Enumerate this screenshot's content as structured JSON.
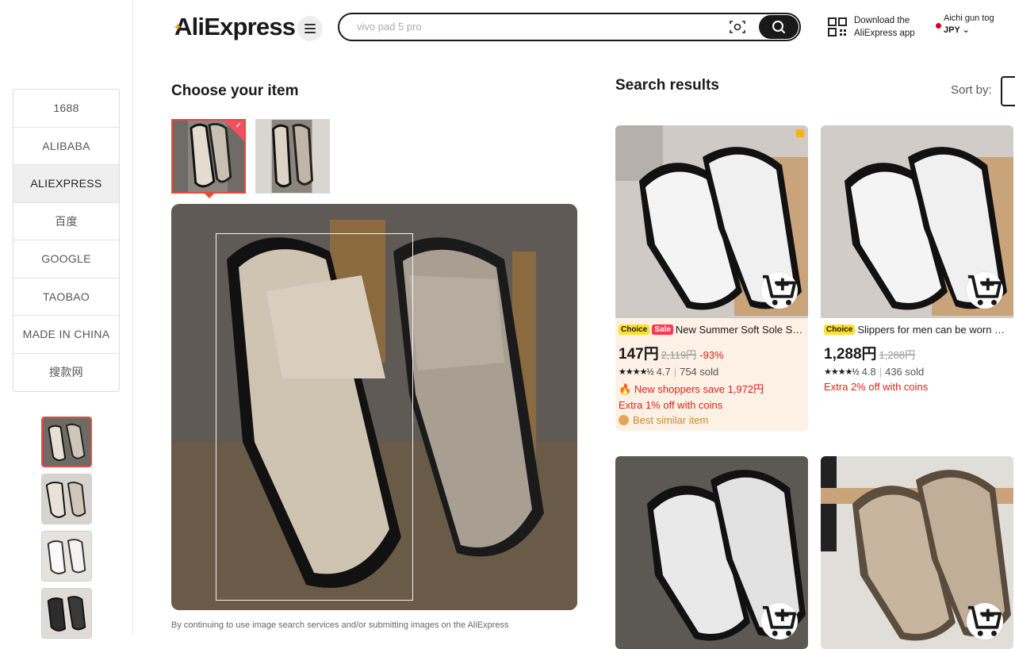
{
  "header": {
    "logo": "AliExpress",
    "search": {
      "placeholder": "vivo pad 5 pro"
    },
    "app_download": {
      "line1": "Download the",
      "line2": "AliExpress app"
    },
    "locale": {
      "location": "Aichi gun tog",
      "currency": "JPY"
    }
  },
  "engines": [
    "1688",
    "ALIBABA",
    "ALIEXPRESS",
    "百度",
    "GOOGLE",
    "TAOBAO",
    "MADE IN CHINA",
    "搜款网"
  ],
  "active_engine": "ALIEXPRESS",
  "choose": {
    "title": "Choose your item",
    "disclaimer": "By continuing to use image search services and/or submitting images on the AliExpress"
  },
  "results": {
    "title": "Search results",
    "sort_label": "Sort by:",
    "cards": [
      {
        "badges": [
          "Choice",
          "Sale"
        ],
        "title": "New Summer Soft Sole Slippers",
        "price": "147円",
        "orig": "2,119円",
        "discount": "-93%",
        "stars": "★★★★½",
        "rating": "4.7",
        "sold": "754 sold",
        "promo1": "New shoppers save 1,972円",
        "promo2": "Extra 1% off with coins",
        "best": "Best similar item"
      },
      {
        "badges": [
          "Choice"
        ],
        "title": "Slippers for men can be worn outside",
        "price": "1,288円",
        "orig": "1,288円",
        "stars": "★★★★½",
        "rating": "4.8",
        "sold": "436 sold",
        "promo1": "Extra 2% off with coins"
      }
    ]
  },
  "colors": {
    "accent": "#e64b3c",
    "choice": "#ffe12e",
    "sale": "#fd384f",
    "price_red": "#e0221a"
  }
}
